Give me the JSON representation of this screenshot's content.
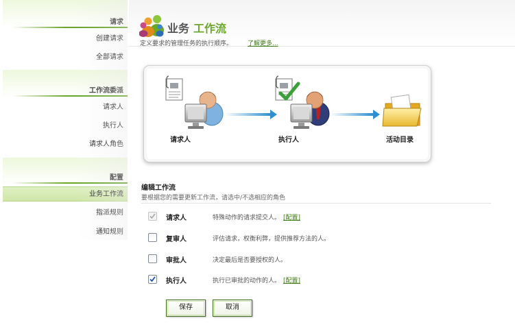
{
  "sidebar": {
    "sections": [
      {
        "title": "请求",
        "items": [
          {
            "label": "创建请求"
          },
          {
            "label": "全部请求"
          }
        ]
      },
      {
        "title": "工作流委派",
        "items": [
          {
            "label": "请求人"
          },
          {
            "label": "执行人"
          },
          {
            "label": "请求人角色"
          }
        ]
      },
      {
        "title": "配置",
        "items": [
          {
            "label": "业务工作流",
            "active": true
          },
          {
            "label": "指派规则"
          },
          {
            "label": "通知规则"
          }
        ]
      }
    ]
  },
  "header": {
    "title_part1": "业务",
    "title_part2": "工作流",
    "subtitle": "定义要求的管理任务的执行顺序。",
    "learn_more": "了解更多..."
  },
  "diagram": {
    "nodes": [
      {
        "label": "请求人",
        "icon": "requester-user-icon"
      },
      {
        "label": "执行人",
        "icon": "executor-user-icon"
      },
      {
        "label": "活动目录",
        "icon": "folder-icon"
      }
    ]
  },
  "edit": {
    "title": "编辑工作流",
    "description": "要根据您的需要更新工作流，请选中/不选相应的角色",
    "roles": [
      {
        "name": "请求人",
        "description": "特殊动作的请求提交人。",
        "link": "[配置]",
        "checked": true,
        "disabled": true
      },
      {
        "name": "复审人",
        "description": "评估请求，权衡利弊，提供推荐方法的人。",
        "checked": false
      },
      {
        "name": "审批人",
        "description": "决定最后是否要授权的人。",
        "checked": false
      },
      {
        "name": "执行人",
        "description": "执行已审批的动作的人。",
        "link": "[配置]",
        "checked": true
      }
    ]
  },
  "buttons": {
    "save": "保存",
    "cancel": "取消"
  },
  "colors": {
    "accent": "#6aa82a",
    "link": "#3d7a12",
    "arrow": "#2f8fd0"
  }
}
